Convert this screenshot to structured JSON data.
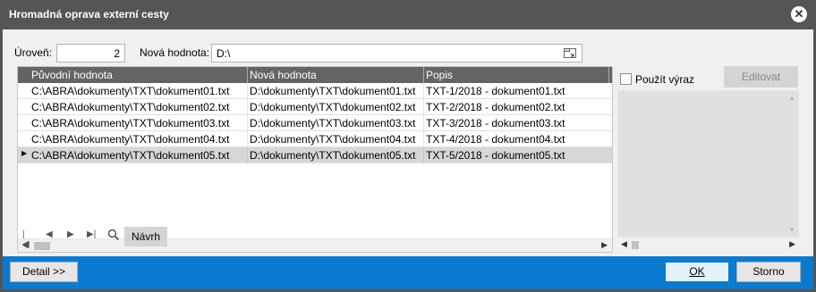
{
  "window": {
    "title": "Hromadná oprava externí cesty",
    "close_icon": "close-icon"
  },
  "fields": {
    "level_label": "Úroveň:",
    "level_value": "2",
    "new_value_label": "Nová hodnota:",
    "new_value": "D:\\",
    "browse_icon": "folder-icon"
  },
  "grid": {
    "columns": [
      "Původní hodnota",
      "Nová hodnota",
      "Popis"
    ],
    "rows": [
      [
        "C:\\ABRA\\dokumenty\\TXT\\dokument01.txt",
        "D:\\dokumenty\\TXT\\dokument01.txt",
        "TXT-1/2018 - dokument01.txt"
      ],
      [
        "C:\\ABRA\\dokumenty\\TXT\\dokument02.txt",
        "D:\\dokumenty\\TXT\\dokument02.txt",
        "TXT-2/2018 - dokument02.txt"
      ],
      [
        "C:\\ABRA\\dokumenty\\TXT\\dokument03.txt",
        "D:\\dokumenty\\TXT\\dokument03.txt",
        "TXT-3/2018 - dokument03.txt"
      ],
      [
        "C:\\ABRA\\dokumenty\\TXT\\dokument04.txt",
        "D:\\dokumenty\\TXT\\dokument04.txt",
        "TXT-4/2018 - dokument04.txt"
      ],
      [
        "C:\\ABRA\\dokumenty\\TXT\\dokument05.txt",
        "D:\\dokumenty\\TXT\\dokument05.txt",
        "TXT-5/2018 - dokument05.txt"
      ]
    ],
    "selected_row": 4
  },
  "side": {
    "use_expression_label": "Použít výraz",
    "use_expression_checked": false,
    "edit_label": "Editovat"
  },
  "nav": {
    "draft_label": "Návrh"
  },
  "footer": {
    "detail_label": "Detail >>",
    "ok_label": "OK",
    "cancel_label": "Storno",
    "accent_color": "#0a7bd0"
  }
}
